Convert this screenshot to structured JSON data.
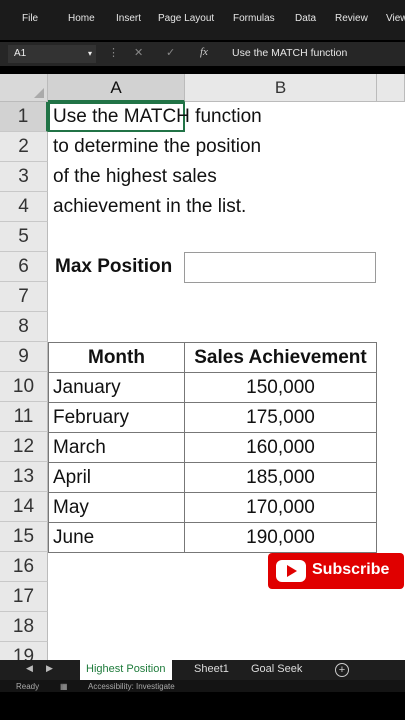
{
  "ribbon": {
    "tabs": [
      "File",
      "Home",
      "Insert",
      "Page Layout",
      "Formulas",
      "Data",
      "Review",
      "View"
    ]
  },
  "formula_bar": {
    "name_box": "A1",
    "fx": "fx",
    "value": "Use the MATCH function"
  },
  "columns": [
    "A",
    "B"
  ],
  "rows": [
    "1",
    "2",
    "3",
    "4",
    "5",
    "6",
    "7",
    "8",
    "9",
    "10",
    "11",
    "12",
    "13",
    "14",
    "15",
    "16",
    "17",
    "18",
    "19"
  ],
  "instructions": [
    "Use the MATCH function",
    "to determine the position",
    "of the highest sales",
    " achievement in the list."
  ],
  "max_position_label": "Max Position",
  "table": {
    "headers": [
      "Month",
      "Sales Achievement"
    ],
    "rows": [
      {
        "month": "January",
        "sales": "150,000"
      },
      {
        "month": "February",
        "sales": "175,000"
      },
      {
        "month": "March",
        "sales": "160,000"
      },
      {
        "month": "April",
        "sales": "185,000"
      },
      {
        "month": "May",
        "sales": "170,000"
      },
      {
        "month": "June",
        "sales": "190,000"
      }
    ]
  },
  "subscribe_label": "Subscribe",
  "sheet_tabs": [
    "Highest Position",
    "Sheet1",
    "Goal Seek"
  ],
  "status": {
    "ready": "Ready",
    "accessibility": "Accessibility: Investigate"
  },
  "colors": {
    "excel_green": "#217346",
    "subscribe_red": "#e00000"
  }
}
